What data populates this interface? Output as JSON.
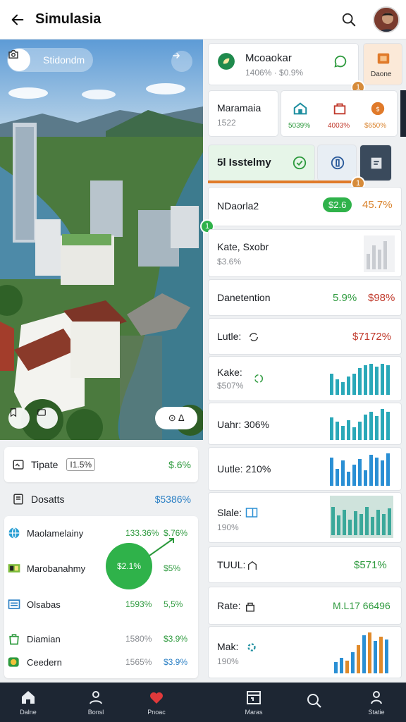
{
  "appbar": {
    "title": "Simulasia"
  },
  "photo": {
    "pill_text": "Stidondm",
    "chip_text": "⊙ ∆"
  },
  "left": {
    "row1": {
      "label": "Tipate",
      "tag": "I1.5%",
      "value": "$.6%"
    },
    "row2": {
      "label": "Dosatts",
      "value": "$5386%"
    },
    "list": [
      {
        "label": "Maolamelainy",
        "v1": "133.36%",
        "v2": "$.76%"
      },
      {
        "label": "Marobanahmy",
        "v1": "",
        "v2": "$5%"
      },
      {
        "label": "Olsabas",
        "v1": "1593%",
        "v2": "5,5%"
      },
      {
        "label": "Diamian",
        "v1": "1580%",
        "v2": "$3.9%"
      },
      {
        "label": "Ceedern",
        "v1": "1565%",
        "v2": "$3.9%"
      }
    ],
    "donut_label": "$2.1%"
  },
  "right": {
    "card1": {
      "title": "Mcoaokar",
      "sub": "1406% · $0.9%",
      "side_label": "Daone"
    },
    "card2": {
      "title": "Maramaia",
      "sub": "1522",
      "icons": [
        "5039%",
        "4003%",
        "$650%"
      ]
    },
    "card3": {
      "title": "5l Isstelmy"
    },
    "rows": [
      {
        "label": "NDaorla2",
        "sub": "",
        "value": "$2.6",
        "value2": "45.7%"
      },
      {
        "label": "Kate, Sxobr",
        "sub": "$3.6%",
        "value": ""
      },
      {
        "label": "Danetention",
        "sub": "",
        "value": "5.9%",
        "value2": "$98%"
      },
      {
        "label": "Lutle:",
        "sub": "",
        "value": "$7172%"
      },
      {
        "label": "Kake:",
        "sub": "$507%",
        "value": ""
      },
      {
        "label": "Uahr: 306%",
        "sub": "",
        "value": ""
      },
      {
        "label": "Uutle: 210%",
        "sub": "",
        "value": ""
      },
      {
        "label": "Slale:",
        "sub": "190%",
        "value": ""
      },
      {
        "label": "TUUL:",
        "sub": "",
        "value": "$571%"
      },
      {
        "label": "Rate:",
        "sub": "",
        "value": "M.L17 66496"
      },
      {
        "label": "Mak:",
        "sub": "190%",
        "value": ""
      }
    ],
    "badges": [
      "1",
      "1",
      "1"
    ]
  },
  "bottom_nav": [
    {
      "label": "Dalne",
      "icon": "home-icon"
    },
    {
      "label": "Bonsl",
      "icon": "profile-icon"
    },
    {
      "label": "Pnoac",
      "icon": "heart-icon"
    },
    {
      "label": "Maras",
      "icon": "calendar-icon"
    },
    {
      "label": "",
      "icon": "search-icon"
    },
    {
      "label": "Statie",
      "icon": "user-icon"
    }
  ],
  "colors": {
    "accent_green": "#2fb24a",
    "accent_orange": "#d68b3a",
    "nav_bg": "#1d2633",
    "teal_bar": "#2aa8b8",
    "blue_bar": "#2a8fd4"
  }
}
